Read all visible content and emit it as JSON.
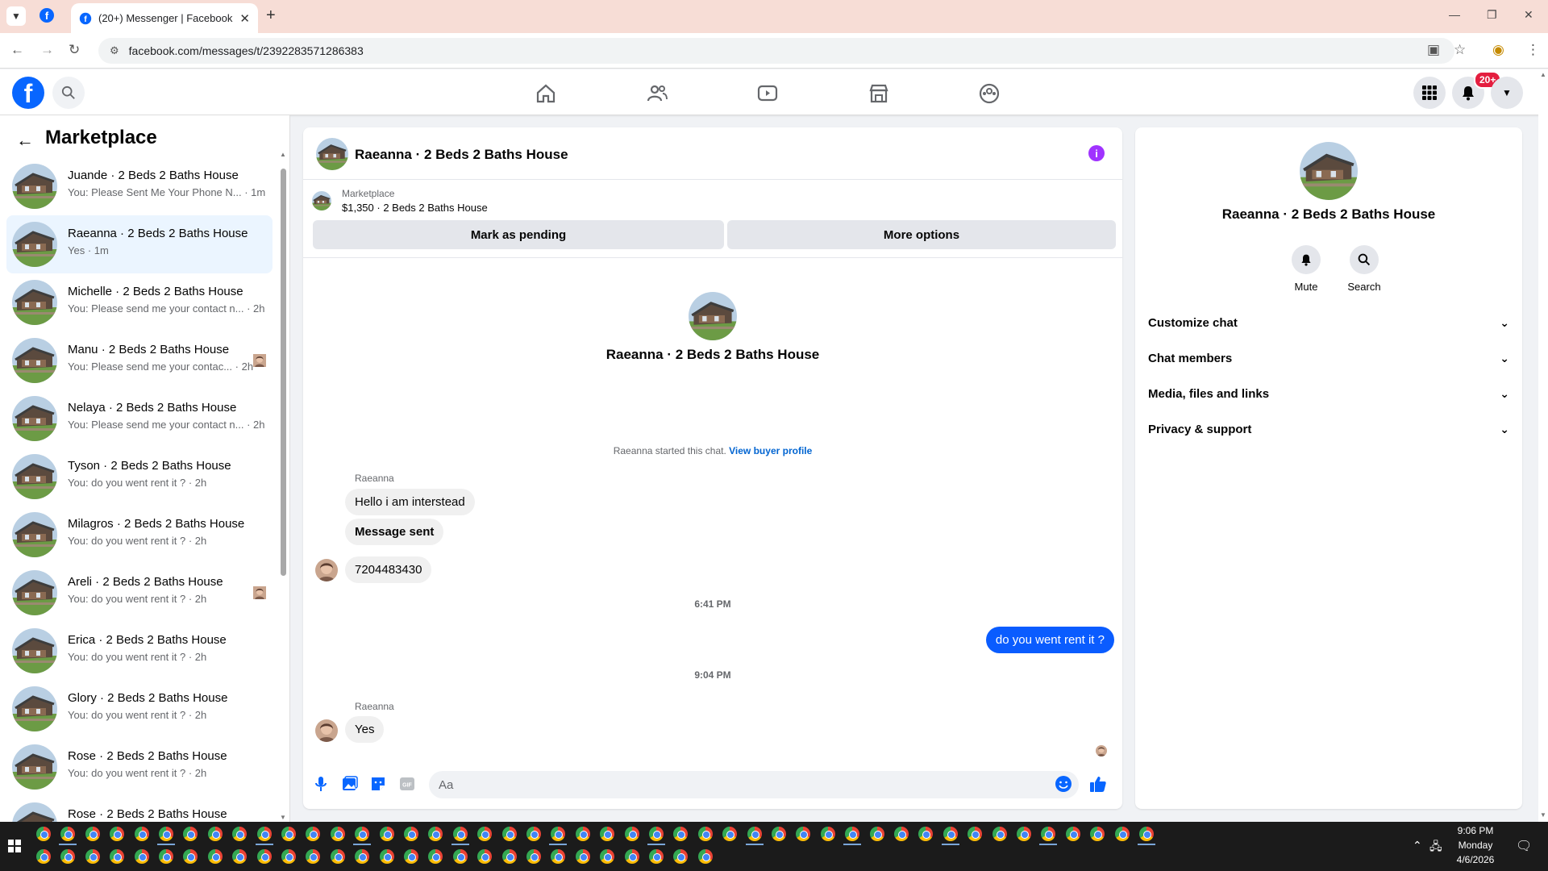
{
  "browser": {
    "tab_title": "(20+) Messenger | Facebook",
    "url": "facebook.com/messages/t/2392283571286383"
  },
  "header": {
    "notification_badge": "20+"
  },
  "sidebar": {
    "title": "Marketplace",
    "conversations": [
      {
        "name": "Juande · 2 Beds 2 Baths House",
        "snippet": "You: Please Sent Me Your Phone N... · 1m",
        "active": false
      },
      {
        "name": "Raeanna · 2 Beds 2 Baths House",
        "snippet": "Yes · 1m",
        "active": true
      },
      {
        "name": "Michelle · 2 Beds 2 Baths House",
        "snippet": "You: Please send me your contact n... · 2h",
        "active": false
      },
      {
        "name": "Manu · 2 Beds 2 Baths House",
        "snippet": "You: Please send me your contac... · 2h",
        "active": false
      },
      {
        "name": "Nelaya · 2 Beds 2 Baths House",
        "snippet": "You: Please send me your contact n... · 2h",
        "active": false
      },
      {
        "name": "Tyson · 2 Beds 2 Baths House",
        "snippet": "You: do you went rent it ? · 2h",
        "active": false
      },
      {
        "name": "Milagros · 2 Beds 2 Baths House",
        "snippet": "You: do you went rent it ? · 2h",
        "active": false
      },
      {
        "name": "Areli · 2 Beds 2 Baths House",
        "snippet": "You: do you went rent it ? · 2h",
        "active": false
      },
      {
        "name": "Erica · 2 Beds 2 Baths House",
        "snippet": "You: do you went rent it ? · 2h",
        "active": false
      },
      {
        "name": "Glory · 2 Beds 2 Baths House",
        "snippet": "You: do you went rent it ? · 2h",
        "active": false
      },
      {
        "name": "Rose · 2 Beds 2 Baths House",
        "snippet": "You: do you went rent it ? · 2h",
        "active": false
      },
      {
        "name": "Rose · 2 Beds 2 Baths House",
        "snippet": "",
        "active": false
      }
    ]
  },
  "chat": {
    "title": "Raeanna · 2 Beds 2 Baths House",
    "marketplace_label": "Marketplace",
    "listing": "$1,350 · 2 Beds 2 Baths House",
    "mark_pending": "Mark as pending",
    "more_options": "More options",
    "intro_name": "Raeanna · 2 Beds 2 Baths House",
    "started_text": "Raeanna started this chat.",
    "view_profile": "View buyer profile",
    "sender_name": "Raeanna",
    "messages": {
      "m1": "Hello i am interstead",
      "m2": "Message sent",
      "m3": "7204483430",
      "ts1": "6:41 PM",
      "m4": "do you went rent it ?",
      "ts2": "9:04 PM",
      "m5": "Yes"
    },
    "composer_placeholder": "Aa"
  },
  "info_panel": {
    "name": "Raeanna · 2 Beds 2 Baths House",
    "mute": "Mute",
    "search": "Search",
    "sections": [
      "Customize chat",
      "Chat members",
      "Media, files and links",
      "Privacy & support"
    ]
  },
  "taskbar": {
    "time": "9:06 PM",
    "day": "Monday",
    "date": "4/6/2026"
  },
  "colors": {
    "facebook_blue": "#0866ff",
    "outgoing_bubble": "#0a5cff",
    "active_conversation": "#ebf5ff",
    "info_icon": "#a033ff",
    "notification_red": "#e41e3f"
  }
}
